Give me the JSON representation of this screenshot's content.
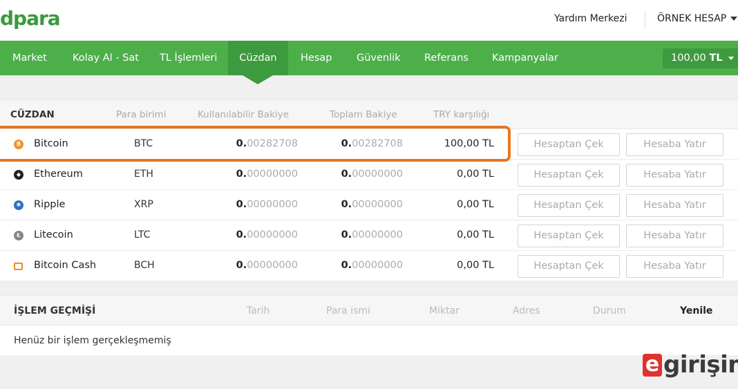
{
  "header": {
    "logo": "dpara",
    "help_link": "Yardım Merkezi",
    "account_label": "ÖRNEK HESAP"
  },
  "nav": {
    "items": [
      "Market",
      "Kolay Al - Sat",
      "TL İşlemleri",
      "Cüzdan",
      "Hesap",
      "Güvenlik",
      "Referans",
      "Kampanyalar"
    ],
    "active": "Cüzdan",
    "balance_amount": "100,00",
    "balance_currency": "TL"
  },
  "wallet": {
    "title": "CÜZDAN",
    "columns": [
      "Para birimi",
      "Kullanılabilir Bakiye",
      "Toplam Bakiye",
      "TRY karşılığı"
    ],
    "withdraw_label": "Hesaptan Çek",
    "deposit_label": "Hesaba Yatır",
    "rows": [
      {
        "name": "Bitcoin",
        "code": "BTC",
        "icon": "bitcoin-icon",
        "icon_color": "#f0922f",
        "available_int": "0.",
        "available_dec": "00282708",
        "total_int": "0.",
        "total_dec": "00282708",
        "try": "100,00 TL"
      },
      {
        "name": "Ethereum",
        "code": "ETH",
        "icon": "ethereum-icon",
        "icon_color": "#222222",
        "available_int": "0.",
        "available_dec": "00000000",
        "total_int": "0.",
        "total_dec": "00000000",
        "try": "0,00 TL"
      },
      {
        "name": "Ripple",
        "code": "XRP",
        "icon": "ripple-icon",
        "icon_color": "#2f6fc4",
        "available_int": "0.",
        "available_dec": "00000000",
        "total_int": "0.",
        "total_dec": "00000000",
        "try": "0,00 TL"
      },
      {
        "name": "Litecoin",
        "code": "LTC",
        "icon": "litecoin-icon",
        "icon_color": "#888888",
        "available_int": "0.",
        "available_dec": "00000000",
        "total_int": "0.",
        "total_dec": "00000000",
        "try": "0,00 TL"
      },
      {
        "name": "Bitcoin Cash",
        "code": "BCH",
        "icon": "bitcoin-cash-icon",
        "icon_color": "#f08a1c",
        "available_int": "0.",
        "available_dec": "00000000",
        "total_int": "0.",
        "total_dec": "00000000",
        "try": "0,00 TL"
      }
    ]
  },
  "history": {
    "title": "İŞLEM GEÇMİŞİ",
    "columns": [
      "Tarih",
      "Para ismi",
      "Miktar",
      "Adres",
      "Durum"
    ],
    "refresh_label": "Yenile",
    "empty_message": "Henüz bir işlem gerçekleşmemiş"
  },
  "watermark": {
    "letter": "e",
    "text": "girişim"
  },
  "colors": {
    "brand_green": "#4caf4a",
    "active_green": "#3e9a3e",
    "highlight_orange": "#e8761e"
  }
}
